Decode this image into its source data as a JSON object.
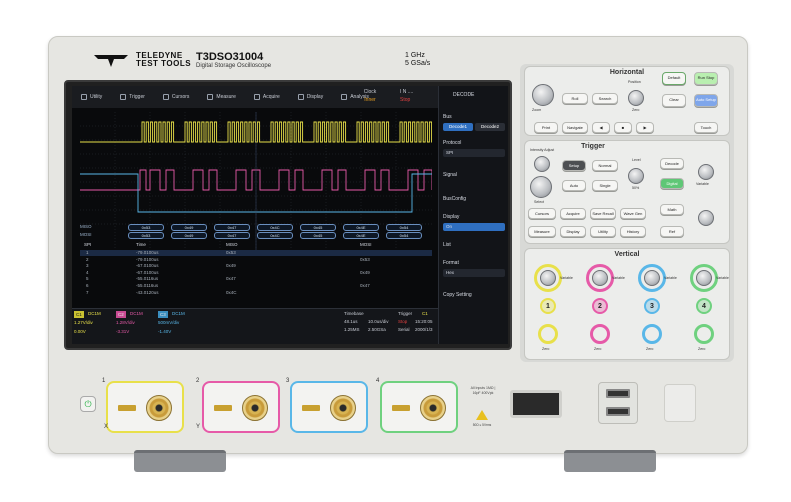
{
  "brand": {
    "line1": "TELEDYNE",
    "line2": "TEST TOOLS"
  },
  "model": {
    "name": "T3DSO31004",
    "subtitle": "Digital Storage Oscilloscope",
    "bandwidth": "1 GHz",
    "sample_rate": "5 GSa/s"
  },
  "screen": {
    "menu": [
      {
        "icon": "utility-icon",
        "label": "Utility"
      },
      {
        "icon": "trigger-icon",
        "label": "Trigger"
      },
      {
        "icon": "cursors-icon",
        "label": "Cursors"
      },
      {
        "icon": "measure-icon",
        "label": "Measure"
      },
      {
        "icon": "acquire-icon",
        "label": "Acquire"
      },
      {
        "icon": "display-icon",
        "label": "Display"
      },
      {
        "icon": "analysis-icon",
        "label": "Analysis"
      }
    ],
    "clock": {
      "label": "Clock",
      "value": "Inner"
    },
    "run_state": {
      "label": "I N ....",
      "value": "Stop"
    },
    "bus_labels": {
      "miso": "MISO",
      "mosi": "MOSI"
    },
    "miso_cells": [
      "0x53",
      "0x49",
      "0x47",
      "0x4C",
      "0x45",
      "0x4E",
      "0x54"
    ],
    "mosi_cells": [
      "0x53",
      "0x49",
      "0x47",
      "0x4C",
      "0x45",
      "0x4E",
      "0x54"
    ],
    "table": {
      "headers": [
        "SPI",
        "Time",
        "MISO",
        "MOSI"
      ],
      "rows": [
        {
          "idx": "1",
          "time": "-79.0100us",
          "miso": "0x53",
          "mosi": ""
        },
        {
          "idx": "2",
          "time": "-79.0100us",
          "miso": "",
          "mosi": "0x53"
        },
        {
          "idx": "3",
          "time": "-67.0100us",
          "miso": "0x49",
          "mosi": ""
        },
        {
          "idx": "4",
          "time": "-67.0100us",
          "miso": "",
          "mosi": "0x49"
        },
        {
          "idx": "5",
          "time": "-55.0116us",
          "miso": "0x47",
          "mosi": ""
        },
        {
          "idx": "6",
          "time": "-55.0116us",
          "miso": "",
          "mosi": "0x47"
        },
        {
          "idx": "7",
          "time": "-43.0120us",
          "miso": "0x4C",
          "mosi": ""
        }
      ]
    },
    "status": {
      "c1_tag": "C1",
      "c1_coupling": "DC1M",
      "c1_scale": "1.27V/div",
      "c1_offset": "0.00V",
      "c2_tag": "C2",
      "c2_coupling": "DC1M",
      "c2_scale": "1.28V/div",
      "c2_offset": "-3.31V",
      "c3_tag": "C3",
      "c3_coupling": "DC1M",
      "c3_scale": "500mV/div",
      "c3_offset": "-1.40V",
      "timebase_label": "Timebase",
      "timebase": "48.1us",
      "timebase_div": "10.0us/div",
      "mem": "1.25MS",
      "srate": "2.50GSa",
      "trigger_label": "Trigger",
      "trig_mode": "Stop",
      "trig_type": "Serial",
      "trig_ch": "C1",
      "time": "15:20:05",
      "date": "2000/1/3"
    },
    "panel": {
      "title": "DECODE",
      "bus_label": "Bus",
      "decode1": "Decode1",
      "decode2": "Decode2",
      "protocol_label": "Protocol",
      "protocol_value": "SPI",
      "signal_label": "Signal",
      "busconfig_label": "BusConfig",
      "display_label": "Display",
      "display_value": "On",
      "list_label": "List",
      "format_label": "Format",
      "format_value": "Hex",
      "copy_label": "Copy Setting"
    }
  },
  "controls": {
    "horizontal_title": "Horizontal",
    "trigger_title": "Trigger",
    "vertical_title": "Vertical",
    "buttons": {
      "roll": "Roll",
      "search": "Search",
      "default": "Default",
      "run_stop": "Run Stop",
      "clear_sweeps": "Clear Sweeps",
      "auto_setup": "Auto Setup",
      "print": "Print",
      "navigate": "Navigate",
      "touch": "Touch",
      "setup": "Setup",
      "normal": "Normal",
      "decode": "Decode",
      "auto": "Auto",
      "single": "Single",
      "digital": "Digital",
      "cursors": "Cursors",
      "acquire": "Acquire",
      "save_recall": "Save Recall",
      "wave_gen": "Wave Gen",
      "math": "Math",
      "measure": "Measure",
      "display_persist": "Display Persist",
      "utility": "Utility",
      "history": "History",
      "ref": "Ref"
    },
    "knob_labels": {
      "zoom": "Zoom",
      "position": "Position",
      "zero": "Zero",
      "level": "Level",
      "intensity": "Intensity Adjust",
      "select": "Select",
      "fifty": "50%",
      "variable": "Variable"
    },
    "channels": [
      "1",
      "2",
      "3",
      "4"
    ],
    "channel_colors": [
      "#e8e04a",
      "#e65aa8",
      "#59b7e8",
      "#6fd17f"
    ]
  },
  "front": {
    "inputs": [
      "1",
      "2",
      "3",
      "4"
    ],
    "x_label": "X",
    "y_label": "Y",
    "aux_text": "All Inputs 1MΩ | 16pF 400Vpk",
    "aux_caption": "50Ω ≤ 5Vrms"
  }
}
